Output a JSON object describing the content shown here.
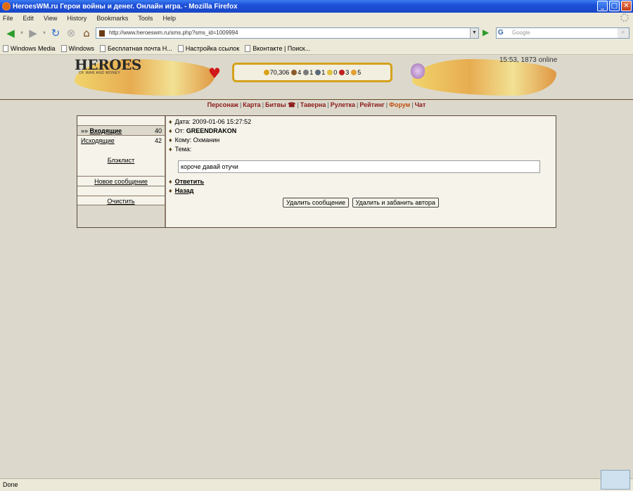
{
  "window": {
    "title": "HeroesWM.ru Герои войны и денег. Онлайн игра. - Mozilla Firefox",
    "buttons": {
      "minimize": "_",
      "maximize": "□",
      "close": "✕"
    }
  },
  "menu": [
    "File",
    "Edit",
    "View",
    "History",
    "Bookmarks",
    "Tools",
    "Help"
  ],
  "nav_toolbar": {
    "url": "http://www.heroeswm.ru/sms.php?sms_id=1009994",
    "search_placeholder": "Google",
    "search_engine_letter": "G"
  },
  "bookmarks": [
    "Windows Media",
    "Windows",
    "Бесплатная почта Н...",
    "Настройка ссылок",
    "Вконтакте | Поиск..."
  ],
  "game_header": {
    "logo": "HEROES",
    "logo_sub": "OF WAR AND MONEY",
    "online": "15:53, 1873 online",
    "resources": [
      {
        "value": "70,306",
        "color": "#d8a21c"
      },
      {
        "value": "4",
        "color": "#8b5a2b"
      },
      {
        "value": "1",
        "color": "#7a7a7a"
      },
      {
        "value": "1",
        "color": "#5a6a7a"
      },
      {
        "value": "0",
        "color": "#e0c040"
      },
      {
        "value": "3",
        "color": "#c02020"
      },
      {
        "value": "5",
        "color": "#e0a030"
      }
    ]
  },
  "site_nav": [
    {
      "label": "Персонаж",
      "color": "#8b1a1a"
    },
    {
      "label": "Карта",
      "color": "#8b1a1a"
    },
    {
      "label": "Битвы ☎",
      "color": "#8b1a1a"
    },
    {
      "label": "Таверна",
      "color": "#8b1a1a"
    },
    {
      "label": "Рулетка",
      "color": "#8b1a1a"
    },
    {
      "label": "Рейтинг",
      "color": "#8b1a1a"
    },
    {
      "label": "Форум",
      "color": "#c05010"
    },
    {
      "label": "Чат",
      "color": "#8b1a1a"
    }
  ],
  "mail_sidebar": {
    "inbox_label": "Входящие",
    "inbox_prefix": "»» ",
    "inbox_count": "40",
    "outbox_label": "Исходящие",
    "outbox_count": "42",
    "blacklist_label": "Блэклист",
    "new_message_label": "Новое сообщение",
    "clear_label": "Очистить"
  },
  "message": {
    "date_label": "Дата:",
    "date_value": "2009-01-06 15:27:52",
    "from_label": "От:",
    "from_value": "GREENDRAKON",
    "to_label": "Кому:",
    "to_value": "Охманин",
    "subject_label": "Тема:",
    "subject_value": "",
    "body": "короче давай отучи",
    "reply_label": "Ответить",
    "back_label": "Назад",
    "delete_button": "Удалить сообщение",
    "delete_block_button": "Удалить и забанить автора"
  },
  "status": "Done"
}
